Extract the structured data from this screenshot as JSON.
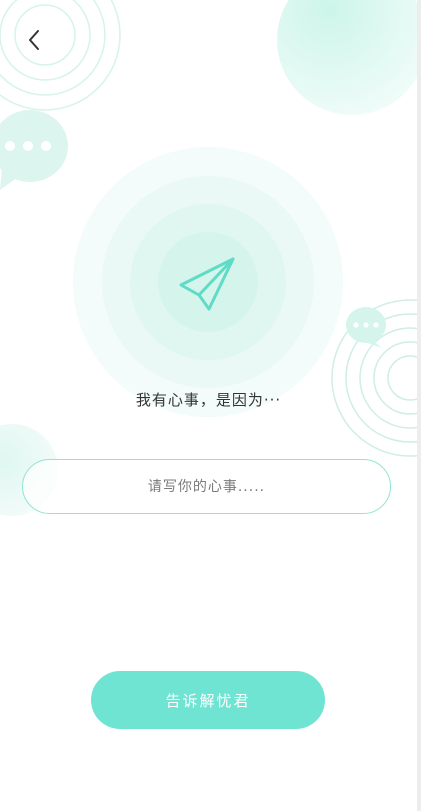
{
  "nav": {
    "back_icon": "chevron-left-icon"
  },
  "hero": {
    "icon": "paper-plane-icon"
  },
  "prompt": {
    "text": "我有心事，是因为···"
  },
  "input": {
    "placeholder": "请写你的心事.....",
    "value": ""
  },
  "action": {
    "submit_label": "告诉解忧君"
  },
  "colors": {
    "accent": "#6fe4d2",
    "accent_light": "#d7f6ef",
    "accent_border": "#8fe6d3",
    "text_primary": "#333333",
    "placeholder": "#7a7a7a"
  }
}
